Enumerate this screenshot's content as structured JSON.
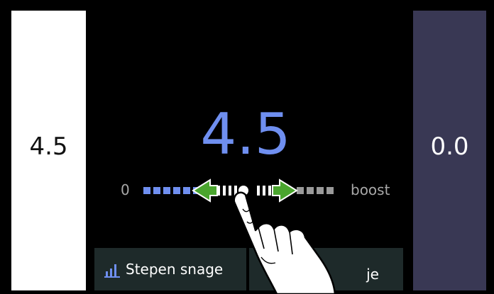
{
  "left_panel": {
    "value": "4.5"
  },
  "right_panel": {
    "value": "0.0"
  },
  "main": {
    "value": "4.5",
    "slider": {
      "min_label": "0",
      "max_label": "boost",
      "level_fraction": 0.45
    }
  },
  "tabs": [
    {
      "label": "Stepen snage",
      "icon": "bar-chart-icon"
    },
    {
      "label": "je",
      "icon": ""
    }
  ],
  "colors": {
    "accent": "#6f8ff0",
    "arrow": "#4aa52e",
    "inactive_segment": "#9a9a9a",
    "right_panel": "#393854",
    "tab_bg": "#1e2a2a"
  }
}
